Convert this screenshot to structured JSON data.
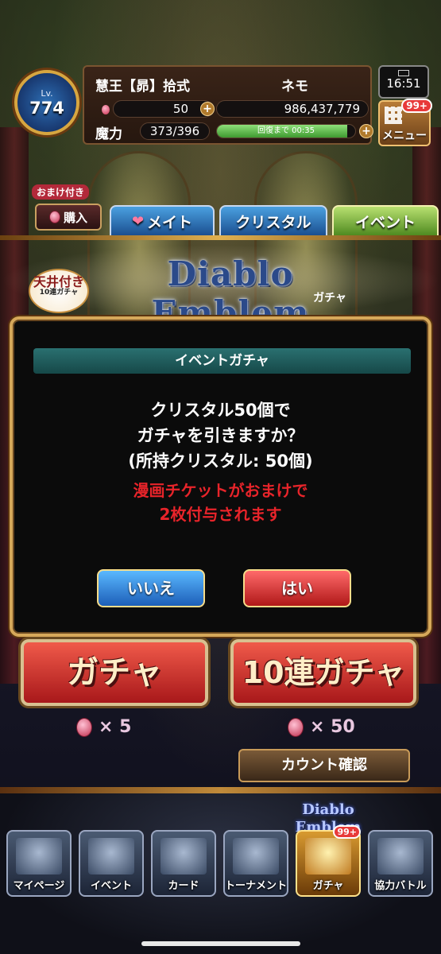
{
  "player": {
    "level_label": "Lv.",
    "level": "774",
    "name": "慧王【昴】拾式",
    "nickname": "ネモ",
    "crystals": "50",
    "gold": "986,437,779",
    "mp_label": "魔力",
    "mp_value": "373/396",
    "mp_fraction": 0.94,
    "mp_recover_text": "回復まで 00:35"
  },
  "status": {
    "time": "16:51"
  },
  "menu": {
    "label": "メニュー",
    "badge": "99+"
  },
  "shop": {
    "bonus_tag": "おまけ付き",
    "buy_label": "購入"
  },
  "tabs": [
    {
      "label": "メイト"
    },
    {
      "label": "クリスタル"
    },
    {
      "label": "イベント"
    }
  ],
  "banner": {
    "ceiling_main": "天井付き",
    "ceiling_sub": "10連ガチャ",
    "logo_main": "Diablo Emblem",
    "logo_sub": "ガチャ"
  },
  "dialog": {
    "title": "イベントガチャ",
    "line1": "クリスタル50個で",
    "line2": "ガチャを引きますか？",
    "line3": "(所持クリスタル: 50個)",
    "bonus1": "漫画チケットがおまけで",
    "bonus2": "2枚付与されます",
    "no_label": "いいえ",
    "yes_label": "はい"
  },
  "gacha": {
    "single_label": "ガチャ",
    "multi_label": "10連ガチャ",
    "single_cost": "× 5",
    "multi_cost": "× 50",
    "count_label": "カウント確認"
  },
  "nav": {
    "logo": "Diablo Emblem",
    "items": [
      {
        "label": "マイページ"
      },
      {
        "label": "イベント"
      },
      {
        "label": "カード"
      },
      {
        "label": "トーナメント"
      },
      {
        "label": "ガチャ",
        "badge": "99+"
      },
      {
        "label": "協力バトル"
      }
    ]
  }
}
